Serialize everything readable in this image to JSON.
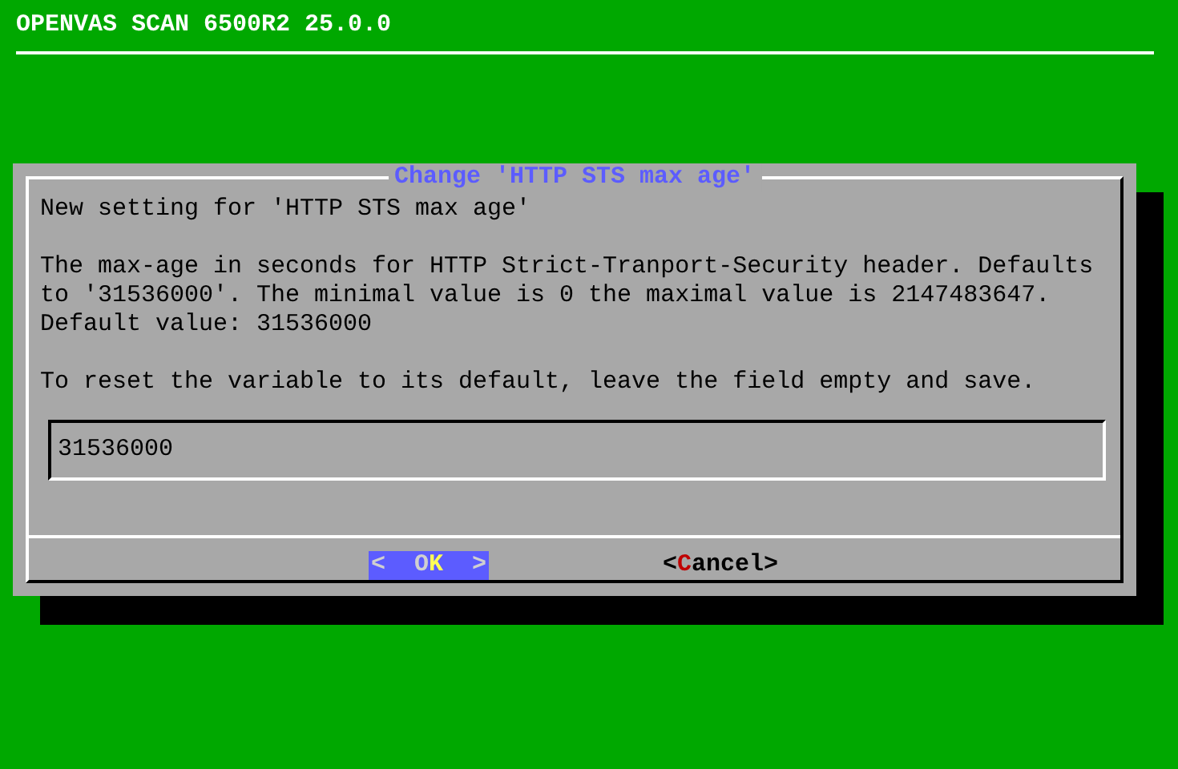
{
  "header": {
    "title": "OPENVAS SCAN 6500R2 25.0.0"
  },
  "dialog": {
    "title": "Change 'HTTP STS max age'",
    "paragraphs": [
      "New setting for 'HTTP STS max age'",
      "The max-age in seconds for HTTP Strict-Tranport-Security header. Defaults\nto '31536000'. The minimal value is 0 the maximal value is 2147483647.\nDefault value: 31536000",
      "To reset the variable to its default, leave the field empty and save."
    ],
    "field": {
      "value": "31536000"
    },
    "buttons": [
      {
        "open": "<",
        "label": "OK",
        "close": ">",
        "selected": true
      },
      {
        "open": "<",
        "label": "Cancel",
        "close": ">",
        "selected": false
      }
    ]
  }
}
